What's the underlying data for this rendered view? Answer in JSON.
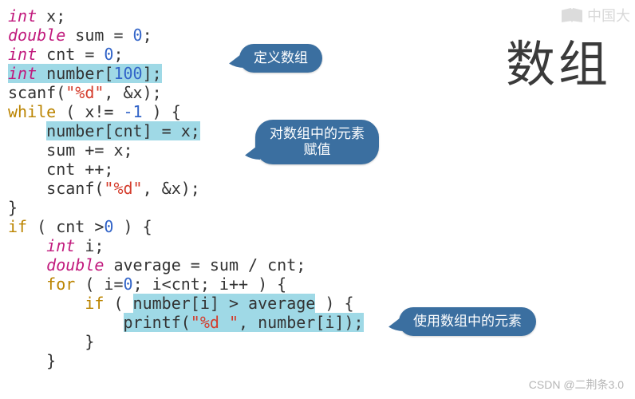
{
  "title": "数组",
  "logo_text": "中国大",
  "attribution": "CSDN @二荆条3.0",
  "callouts": {
    "c1": "定义数组",
    "c2_line1": "对数组中的元素",
    "c2_line2": "赋值",
    "c3": "使用数组中的元素"
  },
  "code": {
    "l1_a": "int",
    "l1_b": " x;",
    "l2_a": "double",
    "l2_b": " sum = ",
    "l2_c": "0",
    "l2_d": ";",
    "l3_a": "int",
    "l3_b": " cnt = ",
    "l3_c": "0",
    "l3_d": ";",
    "l4_a": "int",
    "l4_b": " number[",
    "l4_c": "100",
    "l4_d": "];",
    "l5_a": "scanf(",
    "l5_b": "\"%d\"",
    "l5_c": ", &x);",
    "l6_a": "while",
    "l6_b": " ( x!= ",
    "l6_c": "-1",
    "l6_d": " ) {",
    "l7_a": "    ",
    "l7_b": "number[cnt] = x;",
    "l8": "    sum += x;",
    "l9": "    cnt ++;",
    "l10_a": "    scanf(",
    "l10_b": "\"%d\"",
    "l10_c": ", &x);",
    "l11": "}",
    "l12_a": "if",
    "l12_b": " ( cnt >",
    "l12_c": "0",
    "l12_d": " ) {",
    "l13_a": "    ",
    "l13_b": "int",
    "l13_c": " i;",
    "l14_a": "    ",
    "l14_b": "double",
    "l14_c": " average = sum / cnt;",
    "l15_a": "    ",
    "l15_b": "for",
    "l15_c": " ( i=",
    "l15_d": "0",
    "l15_e": "; i<cnt; i++ ) {",
    "l16_a": "        ",
    "l16_b": "if",
    "l16_c": " ( ",
    "l16_d": "number[i] > average",
    "l16_e": " ) {",
    "l17_a": "            ",
    "l17_b": "printf(",
    "l17_c": "\"%d \"",
    "l17_d": ", number[i]);",
    "l18": "        }",
    "l19": "    }"
  }
}
